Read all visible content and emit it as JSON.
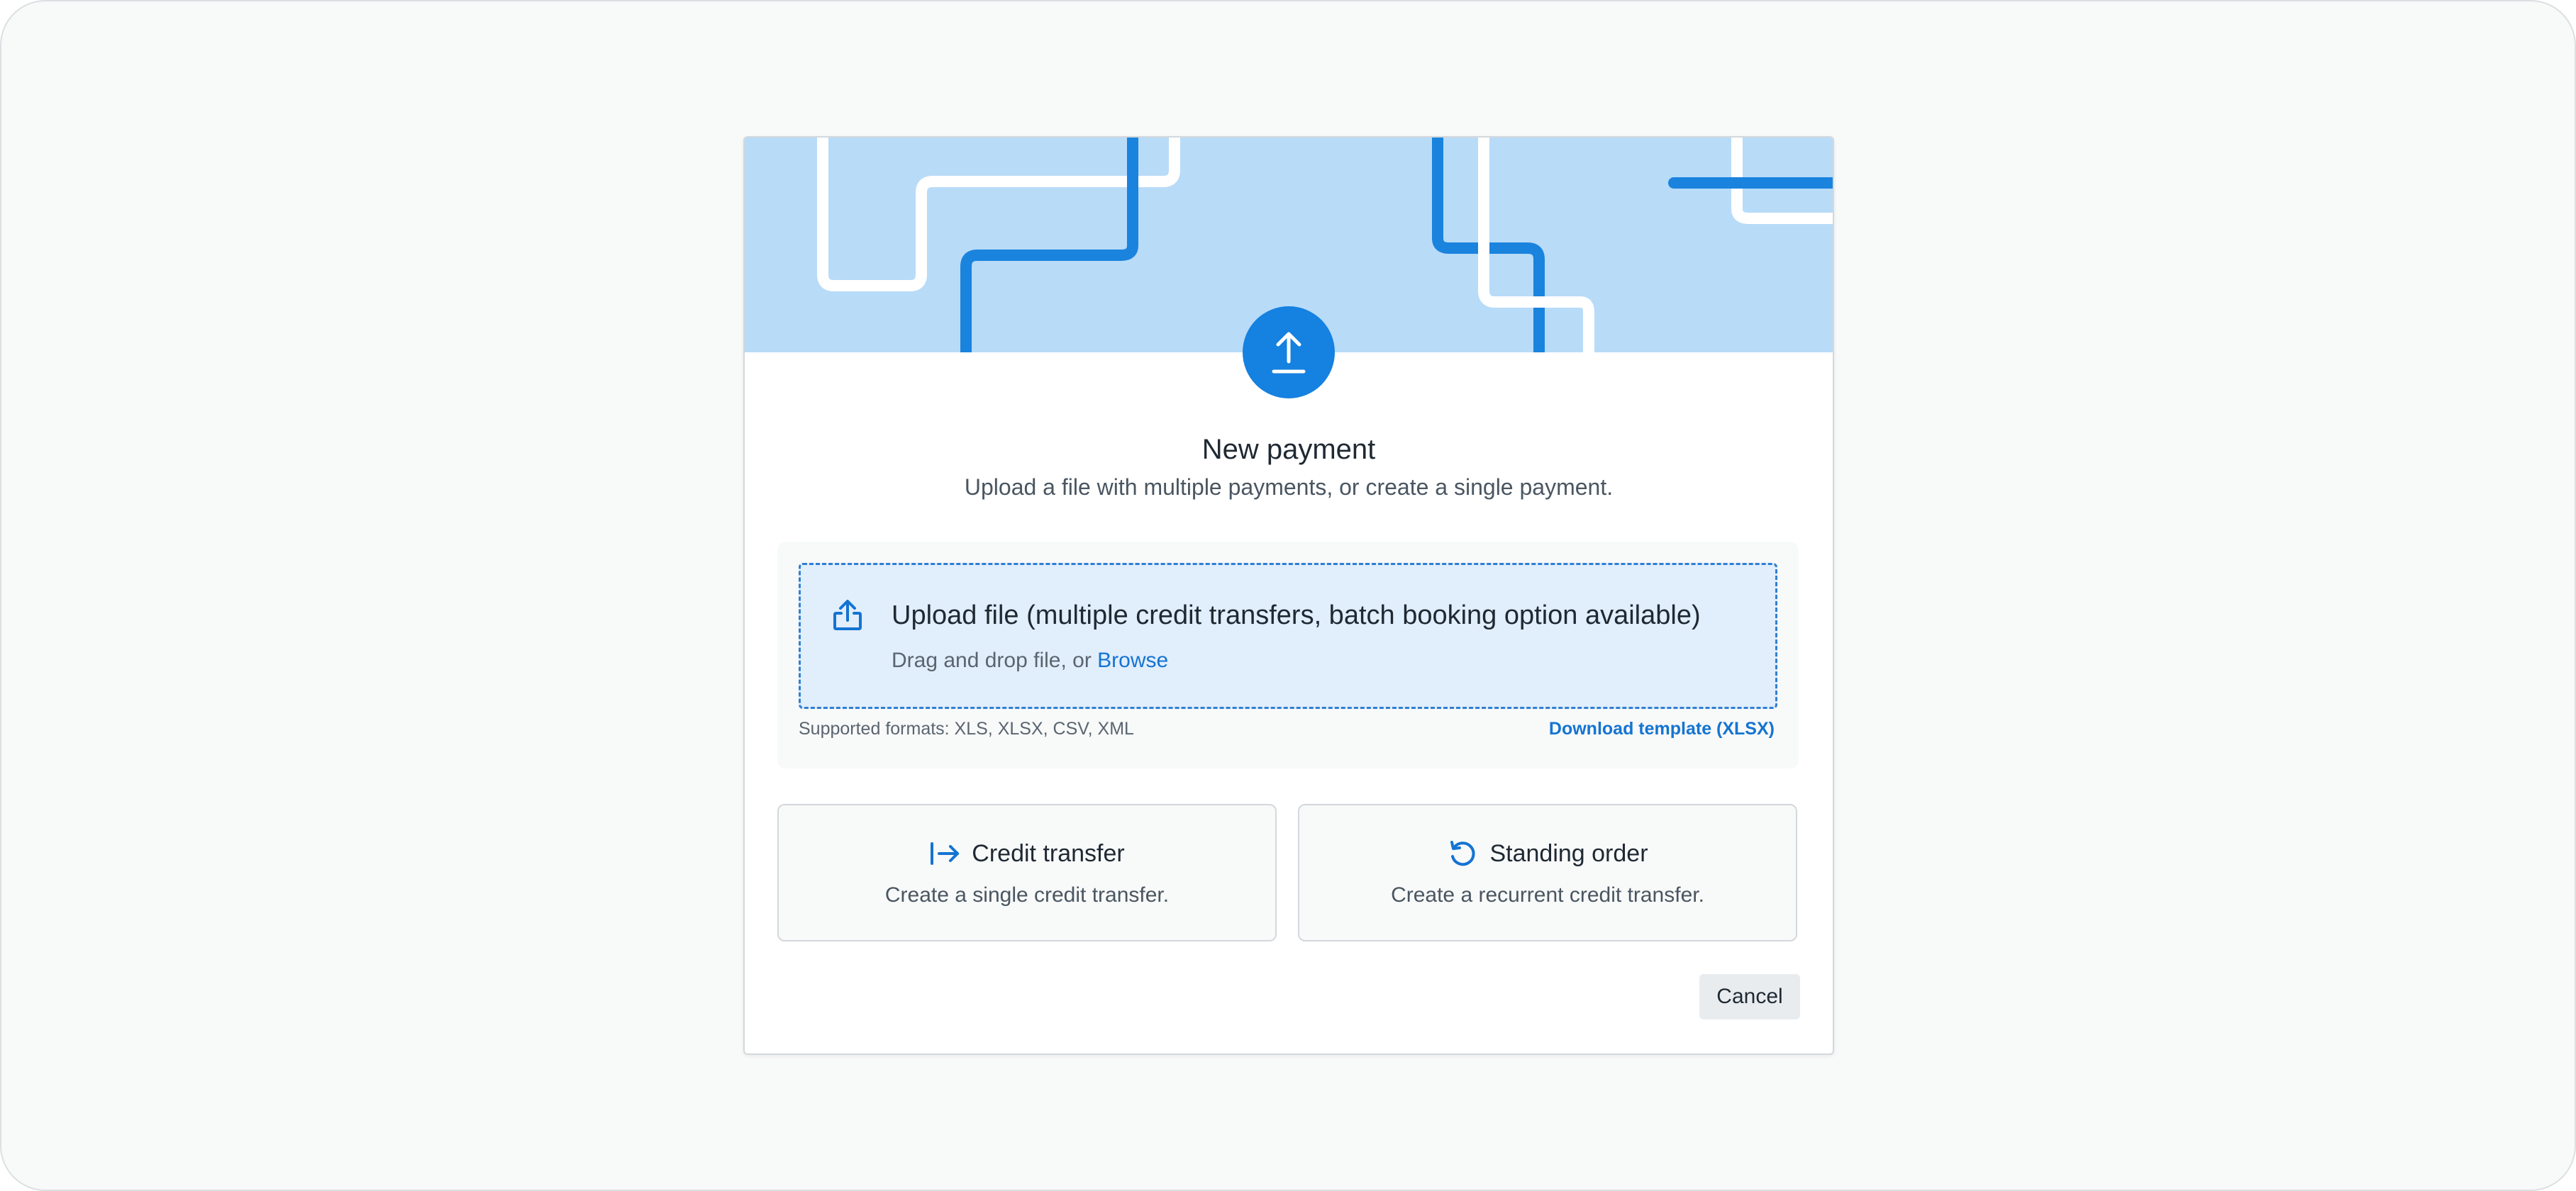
{
  "modal": {
    "title": "New payment",
    "subtitle": "Upload a file with multiple payments, or create a single payment."
  },
  "upload": {
    "title": "Upload file (multiple credit transfers, batch booking option available)",
    "drag_text": "Drag and drop file, or",
    "browse_label": "Browse",
    "formats": "Supported formats: XLS, XLSX, CSV, XML",
    "template_link": "Download template (XLSX)",
    "icon": "upload-share-icon"
  },
  "options": [
    {
      "title": "Credit transfer",
      "description": "Create a single credit transfer.",
      "icon": "arrow-right-to-bar-icon"
    },
    {
      "title": "Standing order",
      "description": "Create a recurrent credit transfer.",
      "icon": "rotate-ccw-icon"
    }
  ],
  "footer": {
    "cancel_label": "Cancel"
  },
  "colors": {
    "accent": "#1581e0",
    "banner_bg": "#b8dbf8",
    "dropzone_bg": "#e1eefc",
    "link": "#1474d2"
  }
}
